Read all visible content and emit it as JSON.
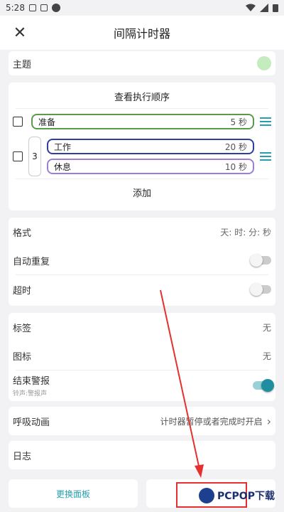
{
  "status_bar": {
    "time": "5:28"
  },
  "app_bar": {
    "title": "间隔计时器",
    "close_icon": "close-icon"
  },
  "theme": {
    "label": "主题",
    "color": "#c4ecbe"
  },
  "sequence": {
    "view_order": "查看执行顺序",
    "items": [
      {
        "name": "准备",
        "seconds": "5 秒",
        "border": "#5a9a4a"
      }
    ],
    "group": {
      "repeat": "3",
      "items": [
        {
          "name": "工作",
          "seconds": "20 秒",
          "border": "#2f3fa0"
        },
        {
          "name": "休息",
          "seconds": "10 秒",
          "border": "#9b7fd4"
        }
      ]
    },
    "add_label": "添加"
  },
  "settings1": {
    "format_label": "格式",
    "format_value": "天: 时: 分: 秒",
    "auto_repeat_label": "自动重复",
    "overtime_label": "超时"
  },
  "settings2": {
    "tag_label": "标签",
    "tag_value": "无",
    "icon_label": "图标",
    "icon_value": "无",
    "end_alarm_label": "结束警报",
    "end_alarm_sub": "铃声:警报声"
  },
  "breath": {
    "label": "呼吸动画",
    "value": "计时器暂停或者完成时开启"
  },
  "log": {
    "label": "日志"
  },
  "footer": {
    "change_panel": "更换面板",
    "watermark": "PCPOP下载"
  },
  "colors": {
    "accent": "#26a0b0",
    "annotation": "#e53030"
  }
}
